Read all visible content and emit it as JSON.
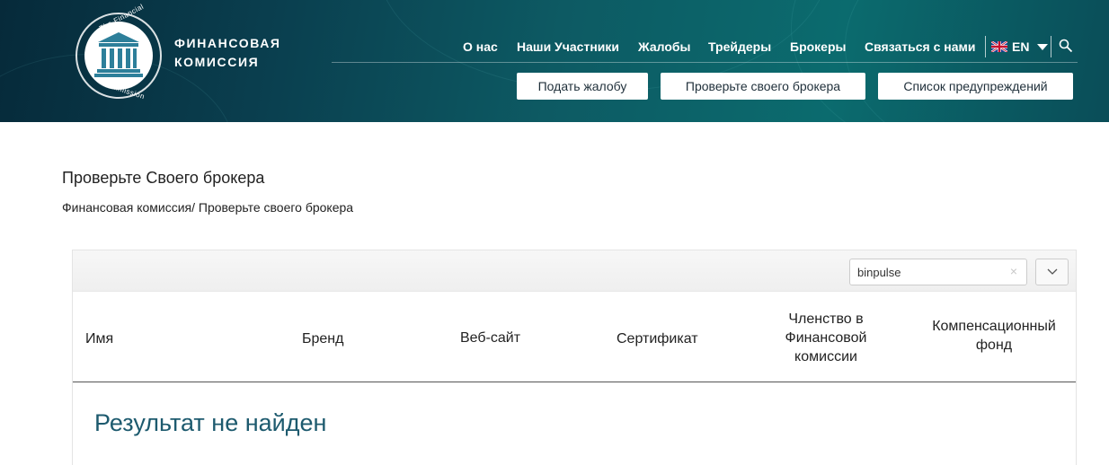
{
  "brand": {
    "line1": "ФИНАНСОВАЯ",
    "line2": "КОМИССИЯ",
    "ring_top": "The Financial",
    "ring_bottom": "Commission"
  },
  "nav": {
    "items": [
      {
        "label": "О нас"
      },
      {
        "label": "Наши Участники"
      },
      {
        "label": "Жалобы"
      },
      {
        "label": "Трейдеры"
      },
      {
        "label": "Брокеры"
      },
      {
        "label": "Связаться с нами"
      }
    ],
    "language": "EN"
  },
  "header_buttons": {
    "complaint": "Подать жалобу",
    "check_broker": "Проверьте своего брокера",
    "warnings": "Список предупреждений"
  },
  "page": {
    "title": "Проверьте Своего брокера",
    "breadcrumb_home": "Финансовая комиссия/",
    "breadcrumb_current": " Проверьте своего брокера"
  },
  "table": {
    "search_value": "binpulse",
    "clear_symbol": "×",
    "columns": [
      {
        "label": "Имя"
      },
      {
        "label": "Бренд"
      },
      {
        "label": "Веб-сайт"
      },
      {
        "label": "Сертификат"
      },
      {
        "label": "Членство в Финансовой комиссии"
      },
      {
        "label": "Компенсационный фонд"
      }
    ],
    "no_result": "Результат не найден"
  }
}
